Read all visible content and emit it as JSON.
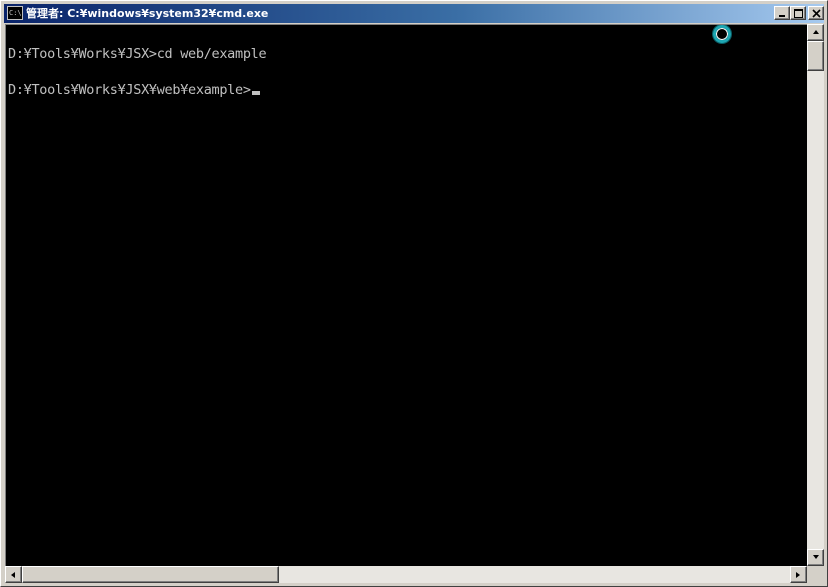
{
  "window": {
    "title": "管理者: C:¥windows¥system32¥cmd.exe",
    "icon": "cmd-icon",
    "icon_text": "C:\\"
  },
  "controls": {
    "minimize": "minimize-icon",
    "maximize": "maximize-icon",
    "close": "close-icon"
  },
  "console": {
    "lines": [
      "D:¥Tools¥Works¥JSX>cd web/example",
      "D:¥Tools¥Works¥JSX¥web¥example>"
    ],
    "text_color": "#c0c0c0",
    "background": "#000000"
  },
  "cursor_icon": "busy-cursor-icon",
  "scrollbars": {
    "vertical_position": 0.0,
    "horizontal_position": 0.0
  }
}
